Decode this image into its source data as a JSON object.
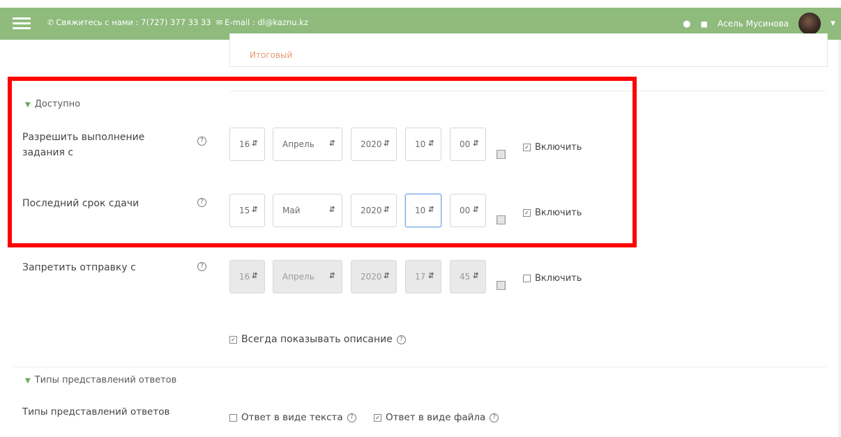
{
  "navbar": {
    "contact": "Свяжитесь с нами : 7(727) 377 33 33",
    "email": "E-mail : dl@kaznu.kz",
    "user_name": "Асель Мусинова"
  },
  "top": {
    "itog": "Итоговый"
  },
  "availability": {
    "section_title": "Доступно",
    "rows": [
      {
        "label_line1": "Разрешить выполнение",
        "label_line2": "задания с",
        "day": "16",
        "month": "Апрель",
        "year": "2020",
        "hour": "10",
        "minute": "00",
        "enable_label": "Включить",
        "enabled": true
      },
      {
        "label_line1": "Последний срок сдачи",
        "label_line2": "",
        "day": "15",
        "month": "Май",
        "year": "2020",
        "hour": "10",
        "minute": "00",
        "enable_label": "Включить",
        "enabled": true
      },
      {
        "label_line1": "Запретить отправку с",
        "label_line2": "",
        "day": "16",
        "month": "Апрель",
        "year": "2020",
        "hour": "17",
        "minute": "45",
        "enable_label": "Включить",
        "enabled": false
      }
    ],
    "always_show": "Всегда показывать описание"
  },
  "submission_types": {
    "section_title": "Типы представлений ответов",
    "label": "Типы представлений ответов",
    "option_text": "Ответ в виде текста",
    "option_file": "Ответ в виде файла"
  },
  "colors": {
    "navbar": "#8fbb7d",
    "highlight": "#ff0000",
    "link": "#e59a73"
  }
}
